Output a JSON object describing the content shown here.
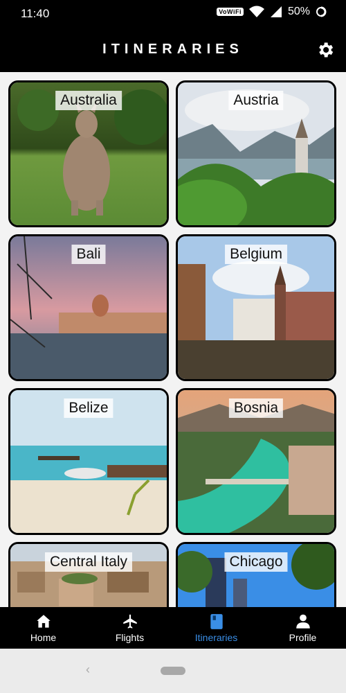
{
  "status_bar": {
    "time": "11:40",
    "network_badge": "VoWiFi",
    "battery": "50%"
  },
  "app_bar": {
    "title": "ITINERARIES",
    "settings_icon": "gear-icon"
  },
  "destinations": [
    {
      "name": "Australia"
    },
    {
      "name": "Austria"
    },
    {
      "name": "Bali"
    },
    {
      "name": "Belgium"
    },
    {
      "name": "Belize"
    },
    {
      "name": "Bosnia"
    },
    {
      "name": "Central Italy"
    },
    {
      "name": "Chicago"
    }
  ],
  "bottom_nav": [
    {
      "label": "Home",
      "icon": "home-icon",
      "active": false
    },
    {
      "label": "Flights",
      "icon": "airplane-icon",
      "active": false
    },
    {
      "label": "Itineraries",
      "icon": "book-icon",
      "active": true
    },
    {
      "label": "Profile",
      "icon": "person-icon",
      "active": false
    }
  ],
  "colors": {
    "accent": "#3a8ee6",
    "bar_background": "#000000"
  }
}
